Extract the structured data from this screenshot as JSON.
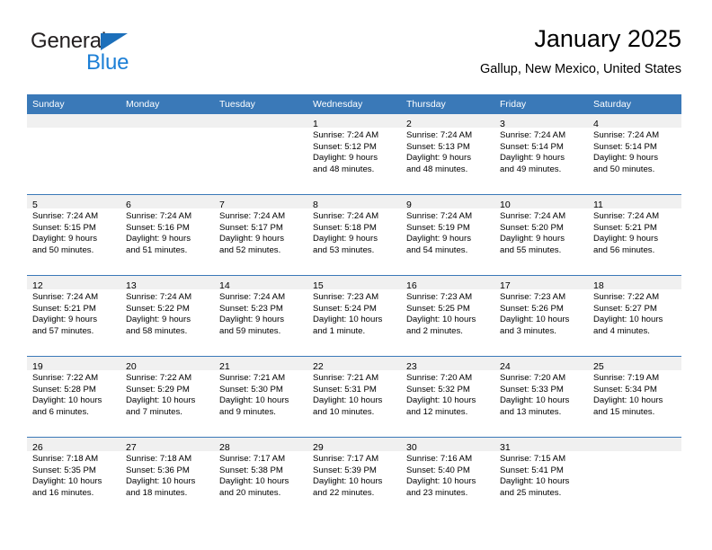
{
  "brand": {
    "name_part1": "General",
    "name_part2": "Blue",
    "accent_color": "#1c7fd6",
    "triangle_color": "#1c6fba"
  },
  "header": {
    "title": "January 2025",
    "subtitle": "Gallup, New Mexico, United States"
  },
  "theme": {
    "header_row_bg": "#3a79b8",
    "day_strip_bg": "#f0f0f0",
    "row_divider": "#3a79b8"
  },
  "calendar": {
    "weekday_headers": [
      "Sunday",
      "Monday",
      "Tuesday",
      "Wednesday",
      "Thursday",
      "Friday",
      "Saturday"
    ],
    "weeks": [
      [
        {
          "day": "",
          "lines": []
        },
        {
          "day": "",
          "lines": []
        },
        {
          "day": "",
          "lines": []
        },
        {
          "day": "1",
          "lines": [
            "Sunrise: 7:24 AM",
            "Sunset: 5:12 PM",
            "Daylight: 9 hours",
            "and 48 minutes."
          ]
        },
        {
          "day": "2",
          "lines": [
            "Sunrise: 7:24 AM",
            "Sunset: 5:13 PM",
            "Daylight: 9 hours",
            "and 48 minutes."
          ]
        },
        {
          "day": "3",
          "lines": [
            "Sunrise: 7:24 AM",
            "Sunset: 5:14 PM",
            "Daylight: 9 hours",
            "and 49 minutes."
          ]
        },
        {
          "day": "4",
          "lines": [
            "Sunrise: 7:24 AM",
            "Sunset: 5:14 PM",
            "Daylight: 9 hours",
            "and 50 minutes."
          ]
        }
      ],
      [
        {
          "day": "5",
          "lines": [
            "Sunrise: 7:24 AM",
            "Sunset: 5:15 PM",
            "Daylight: 9 hours",
            "and 50 minutes."
          ]
        },
        {
          "day": "6",
          "lines": [
            "Sunrise: 7:24 AM",
            "Sunset: 5:16 PM",
            "Daylight: 9 hours",
            "and 51 minutes."
          ]
        },
        {
          "day": "7",
          "lines": [
            "Sunrise: 7:24 AM",
            "Sunset: 5:17 PM",
            "Daylight: 9 hours",
            "and 52 minutes."
          ]
        },
        {
          "day": "8",
          "lines": [
            "Sunrise: 7:24 AM",
            "Sunset: 5:18 PM",
            "Daylight: 9 hours",
            "and 53 minutes."
          ]
        },
        {
          "day": "9",
          "lines": [
            "Sunrise: 7:24 AM",
            "Sunset: 5:19 PM",
            "Daylight: 9 hours",
            "and 54 minutes."
          ]
        },
        {
          "day": "10",
          "lines": [
            "Sunrise: 7:24 AM",
            "Sunset: 5:20 PM",
            "Daylight: 9 hours",
            "and 55 minutes."
          ]
        },
        {
          "day": "11",
          "lines": [
            "Sunrise: 7:24 AM",
            "Sunset: 5:21 PM",
            "Daylight: 9 hours",
            "and 56 minutes."
          ]
        }
      ],
      [
        {
          "day": "12",
          "lines": [
            "Sunrise: 7:24 AM",
            "Sunset: 5:21 PM",
            "Daylight: 9 hours",
            "and 57 minutes."
          ]
        },
        {
          "day": "13",
          "lines": [
            "Sunrise: 7:24 AM",
            "Sunset: 5:22 PM",
            "Daylight: 9 hours",
            "and 58 minutes."
          ]
        },
        {
          "day": "14",
          "lines": [
            "Sunrise: 7:24 AM",
            "Sunset: 5:23 PM",
            "Daylight: 9 hours",
            "and 59 minutes."
          ]
        },
        {
          "day": "15",
          "lines": [
            "Sunrise: 7:23 AM",
            "Sunset: 5:24 PM",
            "Daylight: 10 hours",
            "and 1 minute."
          ]
        },
        {
          "day": "16",
          "lines": [
            "Sunrise: 7:23 AM",
            "Sunset: 5:25 PM",
            "Daylight: 10 hours",
            "and 2 minutes."
          ]
        },
        {
          "day": "17",
          "lines": [
            "Sunrise: 7:23 AM",
            "Sunset: 5:26 PM",
            "Daylight: 10 hours",
            "and 3 minutes."
          ]
        },
        {
          "day": "18",
          "lines": [
            "Sunrise: 7:22 AM",
            "Sunset: 5:27 PM",
            "Daylight: 10 hours",
            "and 4 minutes."
          ]
        }
      ],
      [
        {
          "day": "19",
          "lines": [
            "Sunrise: 7:22 AM",
            "Sunset: 5:28 PM",
            "Daylight: 10 hours",
            "and 6 minutes."
          ]
        },
        {
          "day": "20",
          "lines": [
            "Sunrise: 7:22 AM",
            "Sunset: 5:29 PM",
            "Daylight: 10 hours",
            "and 7 minutes."
          ]
        },
        {
          "day": "21",
          "lines": [
            "Sunrise: 7:21 AM",
            "Sunset: 5:30 PM",
            "Daylight: 10 hours",
            "and 9 minutes."
          ]
        },
        {
          "day": "22",
          "lines": [
            "Sunrise: 7:21 AM",
            "Sunset: 5:31 PM",
            "Daylight: 10 hours",
            "and 10 minutes."
          ]
        },
        {
          "day": "23",
          "lines": [
            "Sunrise: 7:20 AM",
            "Sunset: 5:32 PM",
            "Daylight: 10 hours",
            "and 12 minutes."
          ]
        },
        {
          "day": "24",
          "lines": [
            "Sunrise: 7:20 AM",
            "Sunset: 5:33 PM",
            "Daylight: 10 hours",
            "and 13 minutes."
          ]
        },
        {
          "day": "25",
          "lines": [
            "Sunrise: 7:19 AM",
            "Sunset: 5:34 PM",
            "Daylight: 10 hours",
            "and 15 minutes."
          ]
        }
      ],
      [
        {
          "day": "26",
          "lines": [
            "Sunrise: 7:18 AM",
            "Sunset: 5:35 PM",
            "Daylight: 10 hours",
            "and 16 minutes."
          ]
        },
        {
          "day": "27",
          "lines": [
            "Sunrise: 7:18 AM",
            "Sunset: 5:36 PM",
            "Daylight: 10 hours",
            "and 18 minutes."
          ]
        },
        {
          "day": "28",
          "lines": [
            "Sunrise: 7:17 AM",
            "Sunset: 5:38 PM",
            "Daylight: 10 hours",
            "and 20 minutes."
          ]
        },
        {
          "day": "29",
          "lines": [
            "Sunrise: 7:17 AM",
            "Sunset: 5:39 PM",
            "Daylight: 10 hours",
            "and 22 minutes."
          ]
        },
        {
          "day": "30",
          "lines": [
            "Sunrise: 7:16 AM",
            "Sunset: 5:40 PM",
            "Daylight: 10 hours",
            "and 23 minutes."
          ]
        },
        {
          "day": "31",
          "lines": [
            "Sunrise: 7:15 AM",
            "Sunset: 5:41 PM",
            "Daylight: 10 hours",
            "and 25 minutes."
          ]
        },
        {
          "day": "",
          "lines": []
        }
      ]
    ]
  }
}
